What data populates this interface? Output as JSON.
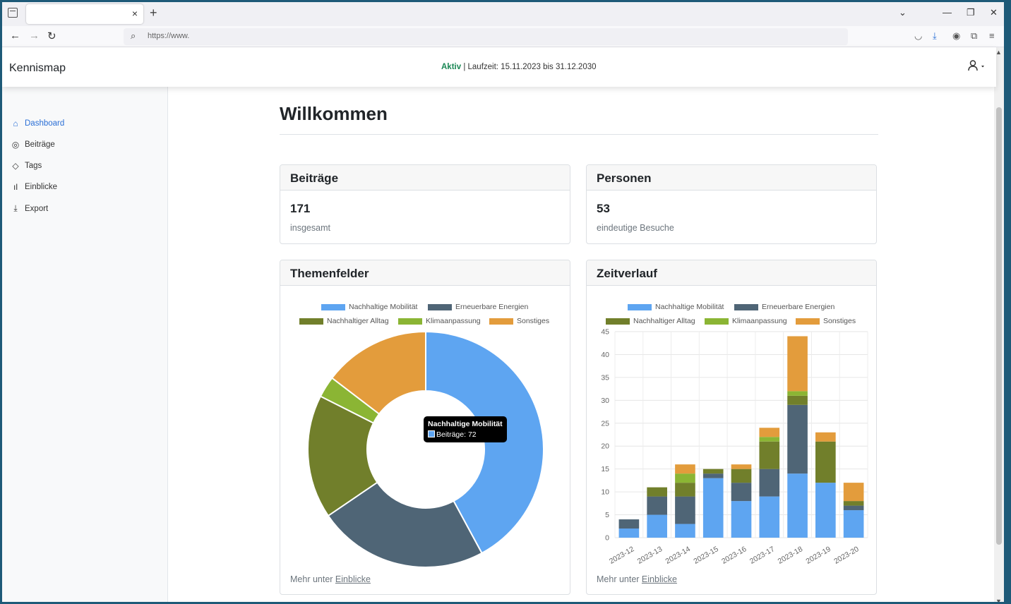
{
  "browser": {
    "url": "https://www.",
    "tab_close": "×",
    "new_tab": "+"
  },
  "app": {
    "brand": "Kennismap",
    "status_active": "Aktiv",
    "status_rest": " | Laufzeit: 15.11.2023 bis 31.12.2030"
  },
  "sidebar": {
    "items": [
      {
        "label": "Dashboard",
        "icon": "home-icon"
      },
      {
        "label": "Beiträge",
        "icon": "location-icon"
      },
      {
        "label": "Tags",
        "icon": "tag-icon"
      },
      {
        "label": "Einblicke",
        "icon": "bar-chart-icon"
      },
      {
        "label": "Export",
        "icon": "download-icon"
      }
    ]
  },
  "main": {
    "title": "Willkommen",
    "cards": {
      "beitraege": {
        "title": "Beiträge",
        "value": "171",
        "sub": "insgesamt"
      },
      "personen": {
        "title": "Personen",
        "value": "53",
        "sub": "eindeutige Besuche"
      },
      "themenfelder": {
        "title": "Themenfelder",
        "footer": "Mehr unter ",
        "footer_link": "Einblicke"
      },
      "zeitverlauf": {
        "title": "Zeitverlauf",
        "footer": "Mehr unter ",
        "footer_link": "Einblicke"
      }
    },
    "tooltip": {
      "title": "Nachhaltige Mobilität",
      "body": "Beiträge: 72"
    }
  },
  "colors": {
    "Nachhaltige Mobilität": "#5ea5f1",
    "Erneuerbare Energien": "#4f6576",
    "Nachhaltiger Alltag": "#717f2b",
    "Klimaanpassung": "#8bb534",
    "Sonstiges": "#e39c3c"
  },
  "chart_data": [
    {
      "type": "pie",
      "variant": "doughnut",
      "legend": [
        "Nachhaltige Mobilität",
        "Erneuerbare Energien",
        "Nachhaltiger Alltag",
        "Klimaanpassung",
        "Sonstiges"
      ],
      "categories": [
        "Nachhaltige Mobilität",
        "Erneuerbare Energien",
        "Nachhaltiger Alltag",
        "Klimaanpassung",
        "Sonstiges"
      ],
      "values": [
        72,
        40,
        29,
        5,
        25
      ]
    },
    {
      "type": "bar",
      "stacked": true,
      "categories": [
        "2023-12",
        "2023-13",
        "2023-14",
        "2023-15",
        "2023-16",
        "2023-17",
        "2023-18",
        "2023-19",
        "2023-20"
      ],
      "ylim": [
        0,
        45
      ],
      "yticks": [
        0,
        5,
        10,
        15,
        20,
        25,
        30,
        35,
        40,
        45
      ],
      "grid": true,
      "legend": [
        "Nachhaltige Mobilität",
        "Erneuerbare Energien",
        "Nachhaltiger Alltag",
        "Klimaanpassung",
        "Sonstiges"
      ],
      "series": [
        {
          "name": "Nachhaltige Mobilität",
          "values": [
            2,
            5,
            3,
            13,
            8,
            9,
            14,
            12,
            6
          ]
        },
        {
          "name": "Erneuerbare Energien",
          "values": [
            2,
            4,
            6,
            1,
            4,
            6,
            15,
            0,
            1
          ]
        },
        {
          "name": "Nachhaltiger Alltag",
          "values": [
            0,
            2,
            3,
            1,
            3,
            6,
            2,
            9,
            1
          ]
        },
        {
          "name": "Klimaanpassung",
          "values": [
            0,
            0,
            2,
            0,
            0,
            1,
            1,
            0,
            0
          ]
        },
        {
          "name": "Sonstiges",
          "values": [
            0,
            0,
            2,
            0,
            1,
            2,
            12,
            2,
            4
          ]
        }
      ]
    }
  ]
}
